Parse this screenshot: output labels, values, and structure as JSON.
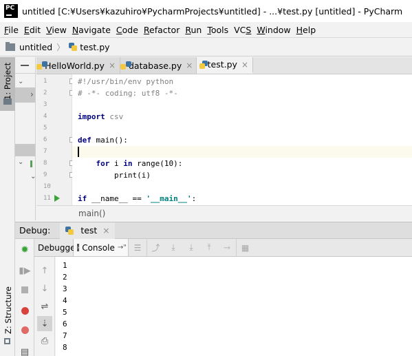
{
  "window": {
    "title": "untitled [C:¥Users¥kazuhiro¥PycharmProjects¥untitled] - ...¥test.py [untitled] - PyCharm",
    "logo_text": "PC"
  },
  "menu": [
    "File",
    "Edit",
    "View",
    "Navigate",
    "Code",
    "Refactor",
    "Run",
    "Tools",
    "VCS",
    "Window",
    "Help"
  ],
  "menu_mnemonics": [
    "F",
    "E",
    "V",
    "N",
    "C",
    "R",
    "R",
    "T",
    "S",
    "W",
    "H"
  ],
  "navbar": {
    "project": "untitled",
    "file": "test.py"
  },
  "left_strip": {
    "project_tab": "1: Project",
    "structure_tab": "Z: Structure"
  },
  "tabs": [
    {
      "label": "HelloWorld.py",
      "active": false
    },
    {
      "label": "database.py",
      "active": false
    },
    {
      "label": "test.py",
      "active": true
    }
  ],
  "close_glyph": "×",
  "editor": {
    "lines": [
      {
        "n": "1",
        "text": "#!/usr/bin/env python"
      },
      {
        "n": "2",
        "text": "# -*- coding: utf8 -*-"
      },
      {
        "n": "3",
        "text": ""
      },
      {
        "n": "4",
        "text": "import csv"
      },
      {
        "n": "5",
        "text": ""
      },
      {
        "n": "6",
        "text": "def main():"
      },
      {
        "n": "7",
        "text": ""
      },
      {
        "n": "8",
        "text": "    for i in range(10):"
      },
      {
        "n": "9",
        "text": "        print(i)"
      },
      {
        "n": "10",
        "text": ""
      },
      {
        "n": "11",
        "text": "if __name__ == '__main__':"
      }
    ],
    "current_line": "7",
    "breadcrumb": "main()"
  },
  "debug": {
    "label": "Debug:",
    "session": "test",
    "tabs": {
      "debugger": "Debugger",
      "console": "Console"
    },
    "console_lines": [
      "1",
      "2",
      "3",
      "4",
      "5",
      "6",
      "7",
      "8"
    ]
  },
  "colors": {
    "keyword": "#000080",
    "string": "#008080",
    "comment": "#808080",
    "run_green": "#3aa33a",
    "debug_red": "#d9423c"
  }
}
